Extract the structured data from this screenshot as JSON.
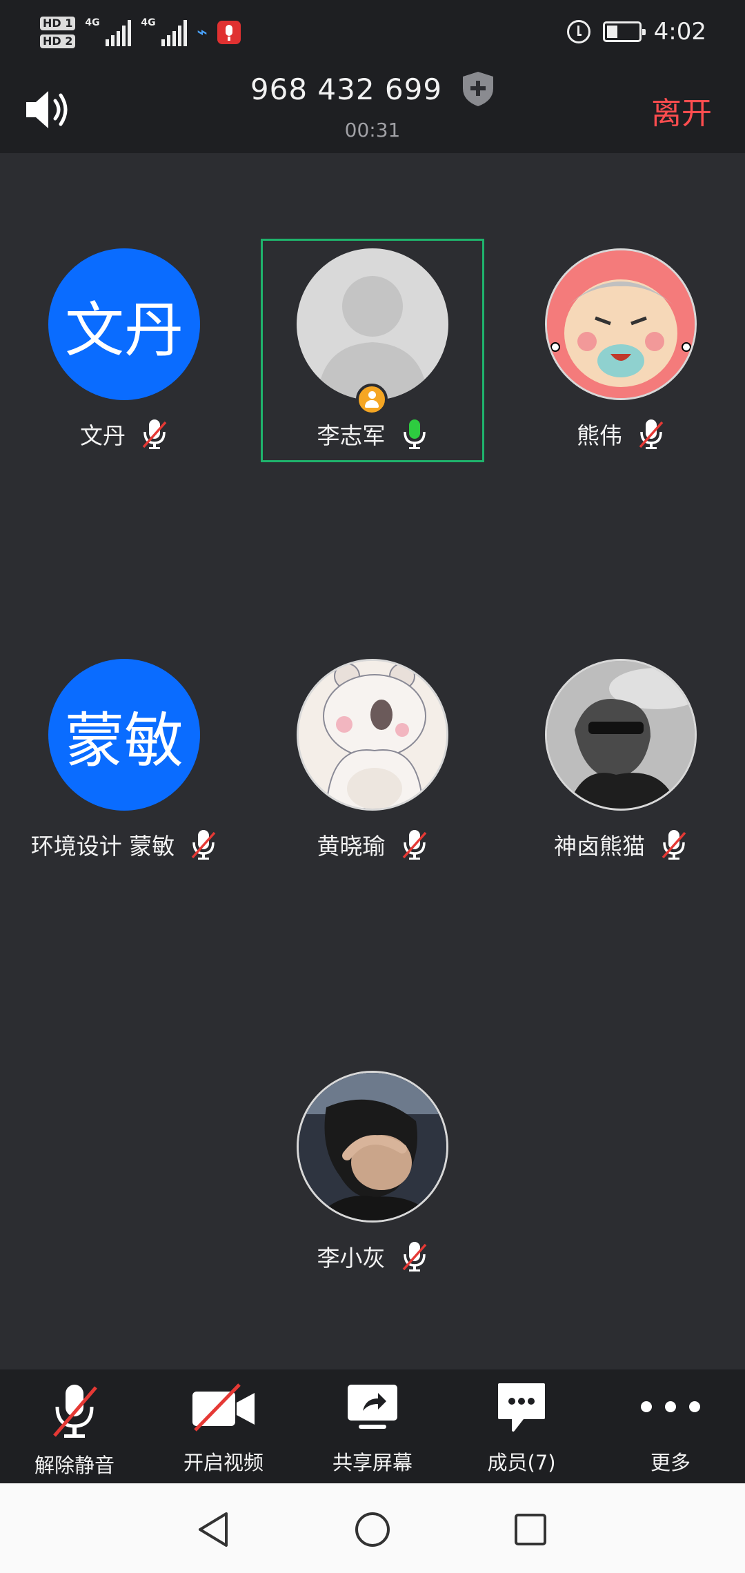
{
  "status_bar": {
    "hd1": "HD 1",
    "hd2": "HD 2",
    "net1": "4G",
    "net2": "4G",
    "battery_level": 0.35,
    "time": "4:02"
  },
  "header": {
    "meeting_id": "968 432 699",
    "duration": "00:31",
    "leave_label": "离开"
  },
  "participants": [
    {
      "name": "文丹",
      "avatar_text": "文丹",
      "avatar_type": "text",
      "mic": "muted"
    },
    {
      "name": "李志军",
      "avatar_type": "default",
      "mic": "on",
      "host": true,
      "active_speaker": true
    },
    {
      "name": "熊伟",
      "avatar_type": "photo",
      "mic": "muted"
    },
    {
      "name": "环境设计 蒙敏",
      "avatar_text": "蒙敏",
      "avatar_type": "text",
      "mic": "muted"
    },
    {
      "name": "黄晓瑜",
      "avatar_type": "photo",
      "mic": "muted"
    },
    {
      "name": "神卤熊猫",
      "avatar_type": "photo",
      "mic": "muted"
    },
    {
      "name": "李小灰",
      "avatar_type": "photo",
      "mic": "muted"
    }
  ],
  "toolbar": {
    "unmute": "解除静音",
    "video": "开启视频",
    "share": "共享屏幕",
    "members": "成员(7)",
    "more": "更多"
  },
  "colors": {
    "background": "#2c2d31",
    "bar": "#1e1f22",
    "accent_blue": "#0a6cff",
    "leave_red": "#ff4d4f",
    "speaking_green": "#1fb36c",
    "mute_red": "#e53935"
  }
}
